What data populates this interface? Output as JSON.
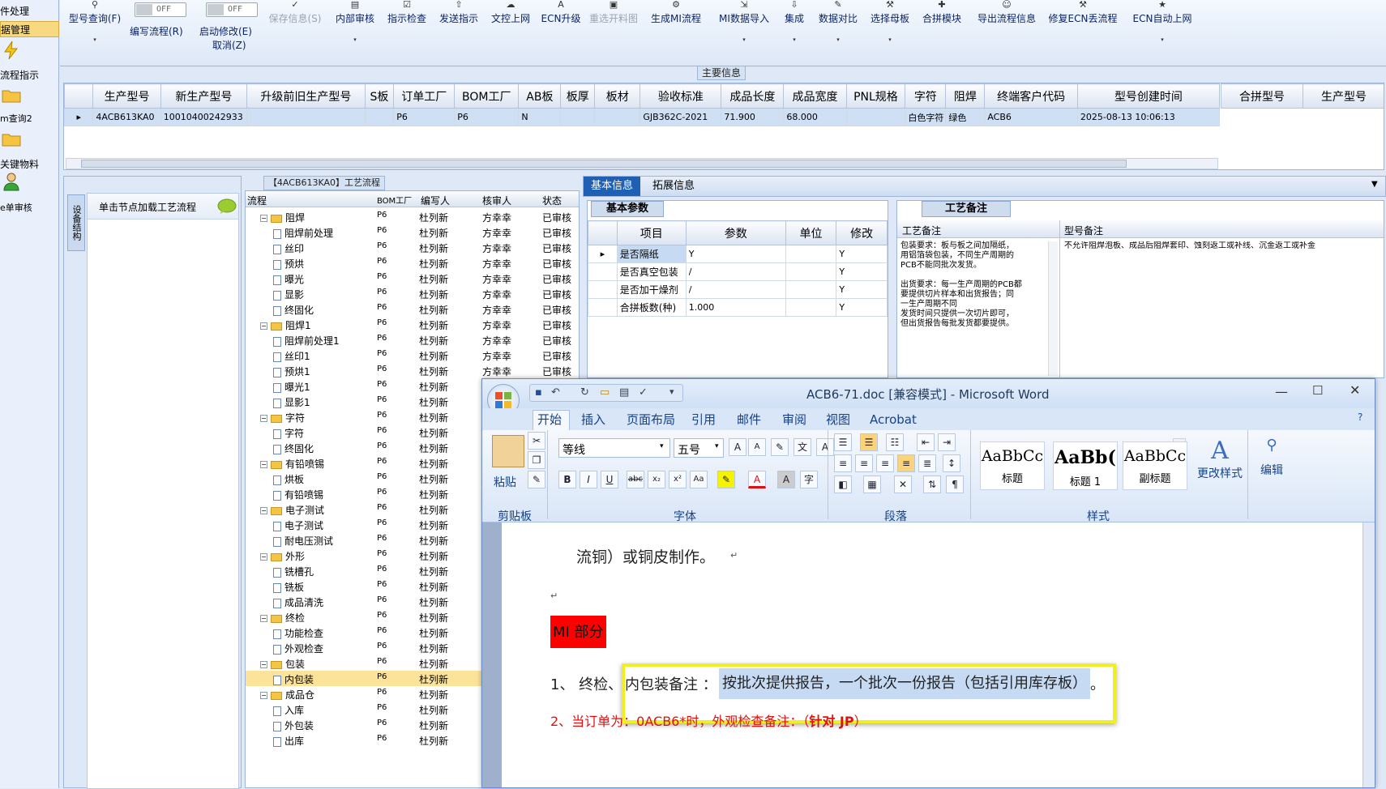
{
  "sidebar": {
    "items": [
      {
        "label": "件处理",
        "icon": "none",
        "selected": false
      },
      {
        "label": "据管理",
        "icon": "none",
        "selected": true
      },
      {
        "label": "流程指示",
        "icon": "lightning-icon"
      },
      {
        "label": "m查询2",
        "icon": "folder-icon"
      },
      {
        "label": "关键物料",
        "icon": "folder-icon"
      },
      {
        "label": "e单审核",
        "icon": "user-icon"
      }
    ]
  },
  "toolbar": {
    "items": [
      {
        "label": "型号查询(F)",
        "icon": "search-icon",
        "dropdown": true
      },
      {
        "label": "编写流程(R)",
        "toggle": "OFF"
      },
      {
        "label": "启动修改(E)",
        "sublabel": "取消(Z)",
        "toggle": "OFF"
      },
      {
        "label": "保存信息(S)",
        "icon": "check-icon",
        "disabled": true
      },
      {
        "label": "内部审核",
        "icon": "print-icon",
        "dropdown": true
      },
      {
        "label": "指示检查",
        "icon": "check-icon"
      },
      {
        "label": "发送指示",
        "icon": "upload-icon"
      },
      {
        "label": "文控上网",
        "icon": "cloud-icon"
      },
      {
        "label": "ECN升级",
        "icon": "letter-a-icon"
      },
      {
        "label": "重选开料图",
        "icon": "image-icon",
        "disabled": true
      },
      {
        "label": "生成MI流程",
        "icon": "gears-icon"
      },
      {
        "label": "MI数据导入",
        "icon": "import-icon",
        "dropdown": true
      },
      {
        "label": "集成",
        "icon": "download-icon",
        "dropdown": true
      },
      {
        "label": "数据对比",
        "icon": "pencil-icon",
        "dropdown": true
      },
      {
        "label": "选择母板",
        "icon": "wrench-icon",
        "dropdown": true
      },
      {
        "label": "合拼模块",
        "icon": "puzzle-icon"
      },
      {
        "label": "导出流程信息",
        "icon": "smiley-icon"
      },
      {
        "label": "修复ECN丢流程",
        "icon": "wrench-icon"
      },
      {
        "label": "ECN自动上网",
        "icon": "star-icon",
        "dropdown": true
      }
    ]
  },
  "main_info": {
    "title": "主要信息",
    "columns": [
      "生产型号",
      "新生产型号",
      "升级前旧生产型号",
      "S板",
      "订单工厂",
      "BOM工厂",
      "AB板",
      "板厚",
      "板材",
      "验收标准",
      "成品长度",
      "成品宽度",
      "PNL规格",
      "字符",
      "阻焊",
      "终端客户代码",
      "型号创建时间"
    ],
    "row": [
      "4ACB613KA0",
      "10010400242933",
      "",
      "",
      "P6",
      "P6",
      "N",
      "",
      "",
      "GJB362C-2021",
      "71.900",
      "68.000",
      "",
      "白色字符",
      "绿色",
      "ACB6",
      "2025-08-13 10:06:13"
    ],
    "side_columns": [
      "合拼型号",
      "生产型号"
    ]
  },
  "left_panel": {
    "vertical_tab": "设备结构",
    "hint": "单击节点加载工艺流程"
  },
  "flow": {
    "title": "【4ACB613KA0】工艺流程",
    "columns": [
      "流程",
      "BOM工厂",
      "编写人",
      "核审人",
      "状态"
    ],
    "rows": [
      {
        "level": 0,
        "name": "阻焊",
        "bom": "P6",
        "writer": "杜列新",
        "reviewer": "方幸幸",
        "status": "已审核"
      },
      {
        "level": 1,
        "name": "阻焊前处理",
        "bom": "P6",
        "writer": "杜列新",
        "reviewer": "方幸幸",
        "status": "已审核"
      },
      {
        "level": 1,
        "name": "丝印",
        "bom": "P6",
        "writer": "杜列新",
        "reviewer": "方幸幸",
        "status": "已审核"
      },
      {
        "level": 1,
        "name": "预烘",
        "bom": "P6",
        "writer": "杜列新",
        "reviewer": "方幸幸",
        "status": "已审核"
      },
      {
        "level": 1,
        "name": "曝光",
        "bom": "P6",
        "writer": "杜列新",
        "reviewer": "方幸幸",
        "status": "已审核"
      },
      {
        "level": 1,
        "name": "显影",
        "bom": "P6",
        "writer": "杜列新",
        "reviewer": "方幸幸",
        "status": "已审核"
      },
      {
        "level": 1,
        "name": "终固化",
        "bom": "P6",
        "writer": "杜列新",
        "reviewer": "方幸幸",
        "status": "已审核"
      },
      {
        "level": 0,
        "name": "阻焊1",
        "bom": "P6",
        "writer": "杜列新",
        "reviewer": "方幸幸",
        "status": "已审核"
      },
      {
        "level": 1,
        "name": "阻焊前处理1",
        "bom": "P6",
        "writer": "杜列新",
        "reviewer": "方幸幸",
        "status": "已审核"
      },
      {
        "level": 1,
        "name": "丝印1",
        "bom": "P6",
        "writer": "杜列新",
        "reviewer": "方幸幸",
        "status": "已审核"
      },
      {
        "level": 1,
        "name": "预烘1",
        "bom": "P6",
        "writer": "杜列新",
        "reviewer": "方幸幸",
        "status": "已审核"
      },
      {
        "level": 1,
        "name": "曝光1",
        "bom": "P6",
        "writer": "杜列新",
        "reviewer": "",
        "status": ""
      },
      {
        "level": 1,
        "name": "显影1",
        "bom": "P6",
        "writer": "杜列新",
        "reviewer": "",
        "status": ""
      },
      {
        "level": 0,
        "name": "字符",
        "bom": "P6",
        "writer": "杜列新",
        "reviewer": "",
        "status": ""
      },
      {
        "level": 1,
        "name": "字符",
        "bom": "P6",
        "writer": "杜列新",
        "reviewer": "",
        "status": ""
      },
      {
        "level": 1,
        "name": "终固化",
        "bom": "P6",
        "writer": "杜列新",
        "reviewer": "",
        "status": ""
      },
      {
        "level": 0,
        "name": "有铅喷锡",
        "bom": "P6",
        "writer": "杜列新",
        "reviewer": "",
        "status": ""
      },
      {
        "level": 1,
        "name": "烘板",
        "bom": "P6",
        "writer": "杜列新",
        "reviewer": "",
        "status": ""
      },
      {
        "level": 1,
        "name": "有铅喷锡",
        "bom": "P6",
        "writer": "杜列新",
        "reviewer": "",
        "status": ""
      },
      {
        "level": 0,
        "name": "电子测试",
        "bom": "P6",
        "writer": "杜列新",
        "reviewer": "",
        "status": ""
      },
      {
        "level": 1,
        "name": "电子测试",
        "bom": "P6",
        "writer": "杜列新",
        "reviewer": "",
        "status": ""
      },
      {
        "level": 1,
        "name": "耐电压测试",
        "bom": "P6",
        "writer": "杜列新",
        "reviewer": "",
        "status": ""
      },
      {
        "level": 0,
        "name": "外形",
        "bom": "P6",
        "writer": "杜列新",
        "reviewer": "",
        "status": ""
      },
      {
        "level": 1,
        "name": "铣槽孔",
        "bom": "P6",
        "writer": "杜列新",
        "reviewer": "",
        "status": ""
      },
      {
        "level": 1,
        "name": "铣板",
        "bom": "P6",
        "writer": "杜列新",
        "reviewer": "",
        "status": ""
      },
      {
        "level": 1,
        "name": "成品清洗",
        "bom": "P6",
        "writer": "杜列新",
        "reviewer": "",
        "status": ""
      },
      {
        "level": 0,
        "name": "终检",
        "bom": "P6",
        "writer": "杜列新",
        "reviewer": "",
        "status": ""
      },
      {
        "level": 1,
        "name": "功能检查",
        "bom": "P6",
        "writer": "杜列新",
        "reviewer": "",
        "status": ""
      },
      {
        "level": 1,
        "name": "外观检查",
        "bom": "P6",
        "writer": "杜列新",
        "reviewer": "",
        "status": ""
      },
      {
        "level": 0,
        "name": "包装",
        "bom": "P6",
        "writer": "杜列新",
        "reviewer": "",
        "status": ""
      },
      {
        "level": 1,
        "name": "内包装",
        "bom": "P6",
        "writer": "杜列新",
        "reviewer": "",
        "status": "",
        "selected": true
      },
      {
        "level": 0,
        "name": "成品仓",
        "bom": "P6",
        "writer": "杜列新",
        "reviewer": "",
        "status": ""
      },
      {
        "level": 1,
        "name": "入库",
        "bom": "P6",
        "writer": "杜列新",
        "reviewer": "",
        "status": ""
      },
      {
        "level": 1,
        "name": "外包装",
        "bom": "P6",
        "writer": "杜列新",
        "reviewer": "",
        "status": ""
      },
      {
        "level": 1,
        "name": "出库",
        "bom": "P6",
        "writer": "杜列新",
        "reviewer": "",
        "status": ""
      }
    ]
  },
  "detail_tabs": {
    "active": "基本信息",
    "other": "拓展信息"
  },
  "basic_params": {
    "title": "基本参数",
    "columns": [
      "项目",
      "参数",
      "单位",
      "修改"
    ],
    "rows": [
      [
        "是否隔纸",
        "Y",
        "",
        "Y"
      ],
      [
        "是否真空包装",
        "/",
        "",
        "Y"
      ],
      [
        "是否加干燥剂",
        "/",
        "",
        "Y"
      ],
      [
        "合拼板数(种)",
        "1.000",
        "",
        "Y"
      ]
    ]
  },
  "process_notes": {
    "title": "工艺备注",
    "col1": "工艺备注",
    "col2": "型号备注",
    "text1_lines": [
      "包装要求：板与板之间加隔纸，",
      "用铝箔袋包装，不同生产周期的",
      "PCB不能同批次发货。",
      "",
      "出货要求：每一生产周期的PCB都",
      "要提供切片样本和出货报告；同",
      "一生产周期不同",
      "发货时间只提供一次切片即可，",
      "但出货报告每批发货都要提供。"
    ],
    "text2": "不允许阻焊泡板、成品后阻焊套印、蚀刻返工或补线、沉金返工或补金"
  },
  "word": {
    "title": "ACB6-71.doc [兼容模式] - Microsoft Word",
    "tabs": [
      "开始",
      "插入",
      "页面布局",
      "引用",
      "邮件",
      "审阅",
      "视图",
      "Acrobat"
    ],
    "active_tab": "开始",
    "font_name": "等线",
    "font_size": "五号",
    "groups": [
      "剪贴板",
      "字体",
      "段落",
      "样式",
      "编辑"
    ],
    "paste_label": "粘贴",
    "styles": [
      {
        "preview": "AaBbCc",
        "name": "标题"
      },
      {
        "preview": "AaBb(",
        "name": "标题 1"
      },
      {
        "preview": "AaBbCc",
        "name": "副标题"
      }
    ],
    "change_styles_label": "更改样式",
    "edit_label": "编辑",
    "doc": {
      "line1": "流铜）或铜皮制作。",
      "mi_heading": "MI 部分",
      "item1_prefix": "1、 终检、",
      "item1_mid": "内包装备注 ：",
      "item1_highlight": "按批次提供报告，一个批次一份报告（包括引用库存板）",
      "item1_end": "。",
      "item2_prefix": "2、当订单为：0ACB6*时，外观检查备注：（",
      "item2_bold": "针对 JP",
      "item2_end": "）"
    }
  },
  "colors": {
    "accent": "#15428b",
    "highlight_yellow": "#f6f300",
    "red_text": "#e01010",
    "mi_bg": "#ff0000",
    "selection_blue": "#c6dbf3"
  }
}
